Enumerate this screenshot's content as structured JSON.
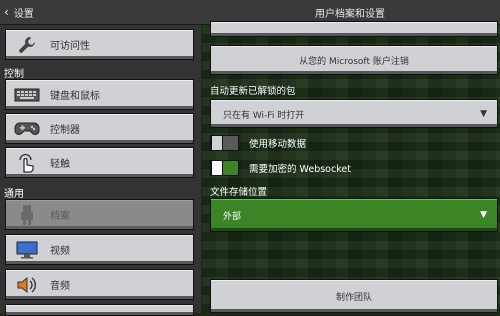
{
  "header": {
    "back_label": "设置",
    "title": "用户档案和设置"
  },
  "sidebar": {
    "accessibility": "可访问性",
    "section_controls": "控制",
    "keyboard_mouse": "键盘和鼠标",
    "controller": "控制器",
    "touch": "轻触",
    "section_general": "通用",
    "profile": "档案",
    "video": "视频",
    "audio": "音频"
  },
  "panel": {
    "top_button": "",
    "signout_button": "从您的 Microsoft 账户注销",
    "auto_update_label": "自动更新已解锁的包",
    "auto_update_value": "只在有 Wi-Fi 时打开",
    "mobile_data_label": "使用移动数据",
    "websocket_label": "需要加密的 Websocket",
    "storage_label": "文件存储位置",
    "storage_value": "外部",
    "credits_button": "制作团队"
  },
  "colors": {
    "accent_green": "#3c8527",
    "button_gray": "#d0d1d4",
    "selected_gray": "#8a8a8a"
  }
}
